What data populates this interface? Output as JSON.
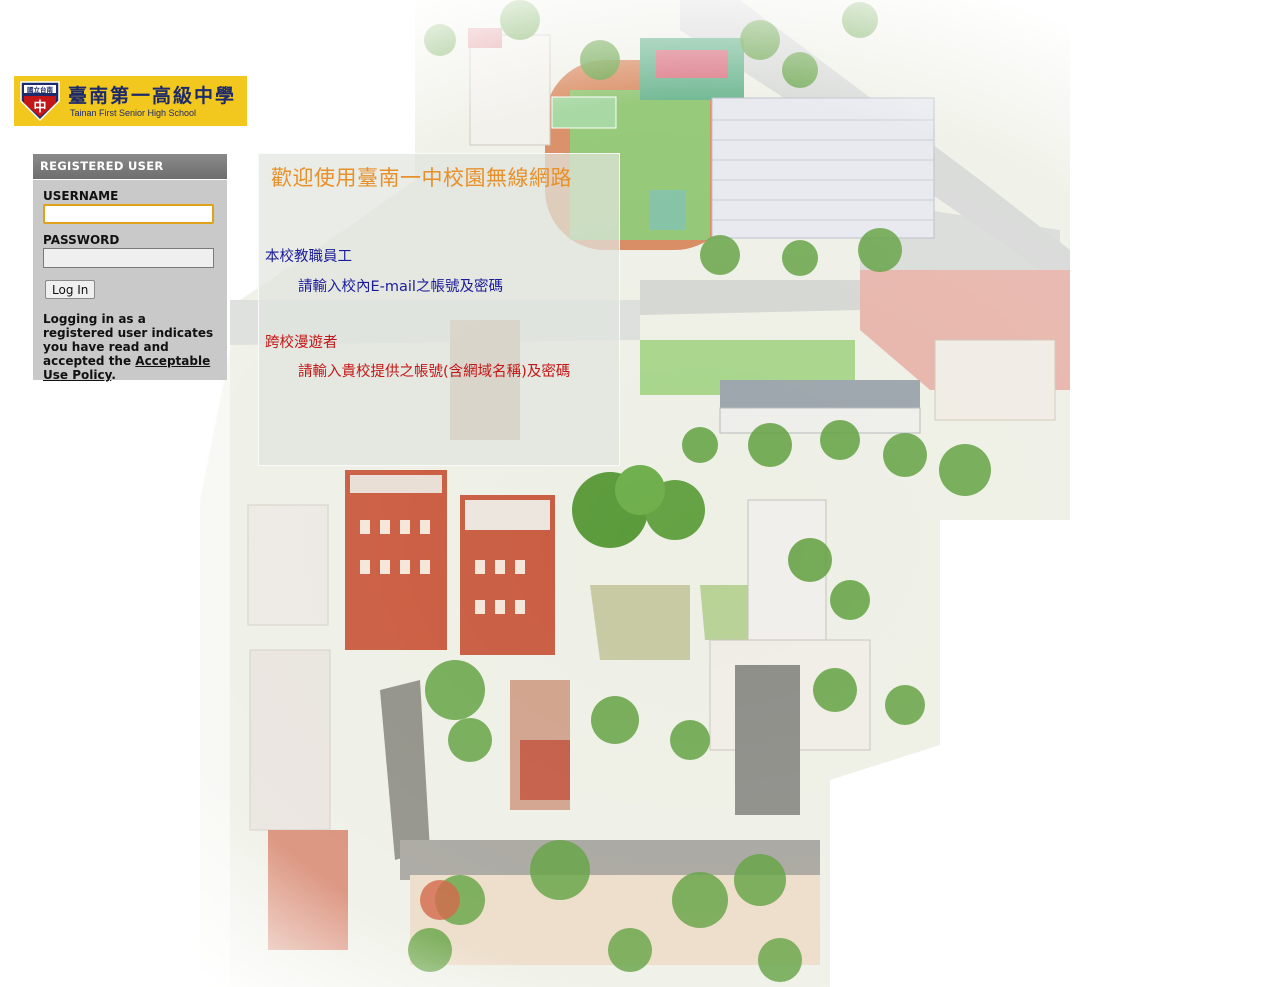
{
  "logo": {
    "name_zh": "臺南第一高級中學",
    "name_en": "Tainan First Senior High School",
    "emblem_text": "國立台南",
    "emblem_char": "中"
  },
  "login": {
    "header": "REGISTERED USER",
    "username_label": "USERNAME",
    "username_value": "",
    "password_label": "PASSWORD",
    "password_value": "",
    "button_label": "Log In",
    "notice_text": "Logging in as a registered user indicates you have read and accepted the ",
    "policy_link": "Acceptable Use Policy",
    "notice_end": "."
  },
  "info": {
    "title": "歡迎使用臺南一中校園無線網路",
    "staff_heading": "本校教職員工",
    "staff_text": "請輸入校內E-mail之帳號及密碼",
    "roam_heading": "跨校漫遊者",
    "roam_text": "請輸入貴校提供之帳號(含網域名稱)及密碼"
  },
  "colors": {
    "logo_bg": "#f3c81e",
    "panel_bg": "#c9c9c9",
    "panel_header": "#7a7a7a",
    "title_orange": "#e8902a",
    "staff_blue": "#1c1c9a",
    "roam_red": "#c41616",
    "focus_outline": "#e0a21c"
  }
}
